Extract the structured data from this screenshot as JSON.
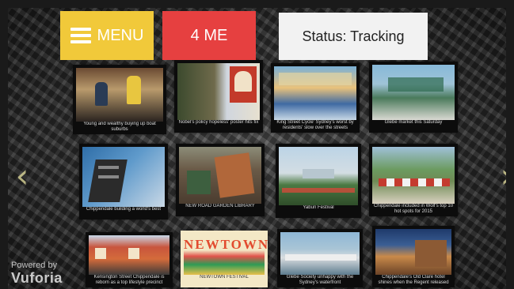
{
  "toolbar": {
    "menu_label": "MENU",
    "me_label": "4 ME",
    "status_text": "Status: Tracking"
  },
  "colors": {
    "menu": "#f1c93a",
    "me": "#e64040",
    "status_bg": "#f2f2f2"
  },
  "cards": [
    {
      "caption": "Young and wealthy buying up boat suburbs"
    },
    {
      "caption": "Nobel's policy hopeless' poster hits fix"
    },
    {
      "caption": "King Street Cycle' Sydney's worst by residents' slow over the streets"
    },
    {
      "caption": "Glebe market this Saturday"
    },
    {
      "caption": "Chippendale building a world's best"
    },
    {
      "caption": "NEW ROAD GARDEN LIBRARY"
    },
    {
      "caption": "Yabun Festival"
    },
    {
      "caption": "Chippendale included in Wolf's top 10 hot spots for 2015"
    },
    {
      "caption": "Kensington Street Chippendale is reborn as a top lifestyle precinct"
    },
    {
      "caption": "NEWTOWN FESTIVAL"
    },
    {
      "caption": "Glebe Society unhappy with the Sydney's waterfront"
    },
    {
      "caption": "Chippendale's Old Clare hotel shines when the Regent released"
    }
  ],
  "newtown": "NEWTOWN",
  "branding": {
    "powered_by": "Powered by",
    "name": "Vuforia"
  }
}
